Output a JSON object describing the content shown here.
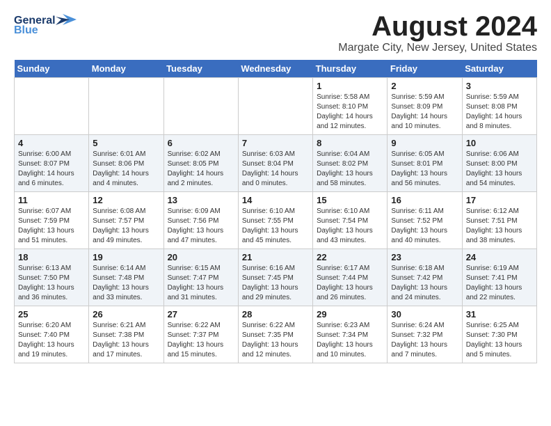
{
  "header": {
    "logo_line1": "General",
    "logo_line2": "Blue",
    "main_title": "August 2024",
    "subtitle": "Margate City, New Jersey, United States"
  },
  "weekdays": [
    "Sunday",
    "Monday",
    "Tuesday",
    "Wednesday",
    "Thursday",
    "Friday",
    "Saturday"
  ],
  "weeks": [
    [
      {
        "day": "",
        "info": ""
      },
      {
        "day": "",
        "info": ""
      },
      {
        "day": "",
        "info": ""
      },
      {
        "day": "",
        "info": ""
      },
      {
        "day": "1",
        "info": "Sunrise: 5:58 AM\nSunset: 8:10 PM\nDaylight: 14 hours\nand 12 minutes."
      },
      {
        "day": "2",
        "info": "Sunrise: 5:59 AM\nSunset: 8:09 PM\nDaylight: 14 hours\nand 10 minutes."
      },
      {
        "day": "3",
        "info": "Sunrise: 5:59 AM\nSunset: 8:08 PM\nDaylight: 14 hours\nand 8 minutes."
      }
    ],
    [
      {
        "day": "4",
        "info": "Sunrise: 6:00 AM\nSunset: 8:07 PM\nDaylight: 14 hours\nand 6 minutes."
      },
      {
        "day": "5",
        "info": "Sunrise: 6:01 AM\nSunset: 8:06 PM\nDaylight: 14 hours\nand 4 minutes."
      },
      {
        "day": "6",
        "info": "Sunrise: 6:02 AM\nSunset: 8:05 PM\nDaylight: 14 hours\nand 2 minutes."
      },
      {
        "day": "7",
        "info": "Sunrise: 6:03 AM\nSunset: 8:04 PM\nDaylight: 14 hours\nand 0 minutes."
      },
      {
        "day": "8",
        "info": "Sunrise: 6:04 AM\nSunset: 8:02 PM\nDaylight: 13 hours\nand 58 minutes."
      },
      {
        "day": "9",
        "info": "Sunrise: 6:05 AM\nSunset: 8:01 PM\nDaylight: 13 hours\nand 56 minutes."
      },
      {
        "day": "10",
        "info": "Sunrise: 6:06 AM\nSunset: 8:00 PM\nDaylight: 13 hours\nand 54 minutes."
      }
    ],
    [
      {
        "day": "11",
        "info": "Sunrise: 6:07 AM\nSunset: 7:59 PM\nDaylight: 13 hours\nand 51 minutes."
      },
      {
        "day": "12",
        "info": "Sunrise: 6:08 AM\nSunset: 7:57 PM\nDaylight: 13 hours\nand 49 minutes."
      },
      {
        "day": "13",
        "info": "Sunrise: 6:09 AM\nSunset: 7:56 PM\nDaylight: 13 hours\nand 47 minutes."
      },
      {
        "day": "14",
        "info": "Sunrise: 6:10 AM\nSunset: 7:55 PM\nDaylight: 13 hours\nand 45 minutes."
      },
      {
        "day": "15",
        "info": "Sunrise: 6:10 AM\nSunset: 7:54 PM\nDaylight: 13 hours\nand 43 minutes."
      },
      {
        "day": "16",
        "info": "Sunrise: 6:11 AM\nSunset: 7:52 PM\nDaylight: 13 hours\nand 40 minutes."
      },
      {
        "day": "17",
        "info": "Sunrise: 6:12 AM\nSunset: 7:51 PM\nDaylight: 13 hours\nand 38 minutes."
      }
    ],
    [
      {
        "day": "18",
        "info": "Sunrise: 6:13 AM\nSunset: 7:50 PM\nDaylight: 13 hours\nand 36 minutes."
      },
      {
        "day": "19",
        "info": "Sunrise: 6:14 AM\nSunset: 7:48 PM\nDaylight: 13 hours\nand 33 minutes."
      },
      {
        "day": "20",
        "info": "Sunrise: 6:15 AM\nSunset: 7:47 PM\nDaylight: 13 hours\nand 31 minutes."
      },
      {
        "day": "21",
        "info": "Sunrise: 6:16 AM\nSunset: 7:45 PM\nDaylight: 13 hours\nand 29 minutes."
      },
      {
        "day": "22",
        "info": "Sunrise: 6:17 AM\nSunset: 7:44 PM\nDaylight: 13 hours\nand 26 minutes."
      },
      {
        "day": "23",
        "info": "Sunrise: 6:18 AM\nSunset: 7:42 PM\nDaylight: 13 hours\nand 24 minutes."
      },
      {
        "day": "24",
        "info": "Sunrise: 6:19 AM\nSunset: 7:41 PM\nDaylight: 13 hours\nand 22 minutes."
      }
    ],
    [
      {
        "day": "25",
        "info": "Sunrise: 6:20 AM\nSunset: 7:40 PM\nDaylight: 13 hours\nand 19 minutes."
      },
      {
        "day": "26",
        "info": "Sunrise: 6:21 AM\nSunset: 7:38 PM\nDaylight: 13 hours\nand 17 minutes."
      },
      {
        "day": "27",
        "info": "Sunrise: 6:22 AM\nSunset: 7:37 PM\nDaylight: 13 hours\nand 15 minutes."
      },
      {
        "day": "28",
        "info": "Sunrise: 6:22 AM\nSunset: 7:35 PM\nDaylight: 13 hours\nand 12 minutes."
      },
      {
        "day": "29",
        "info": "Sunrise: 6:23 AM\nSunset: 7:34 PM\nDaylight: 13 hours\nand 10 minutes."
      },
      {
        "day": "30",
        "info": "Sunrise: 6:24 AM\nSunset: 7:32 PM\nDaylight: 13 hours\nand 7 minutes."
      },
      {
        "day": "31",
        "info": "Sunrise: 6:25 AM\nSunset: 7:30 PM\nDaylight: 13 hours\nand 5 minutes."
      }
    ]
  ]
}
